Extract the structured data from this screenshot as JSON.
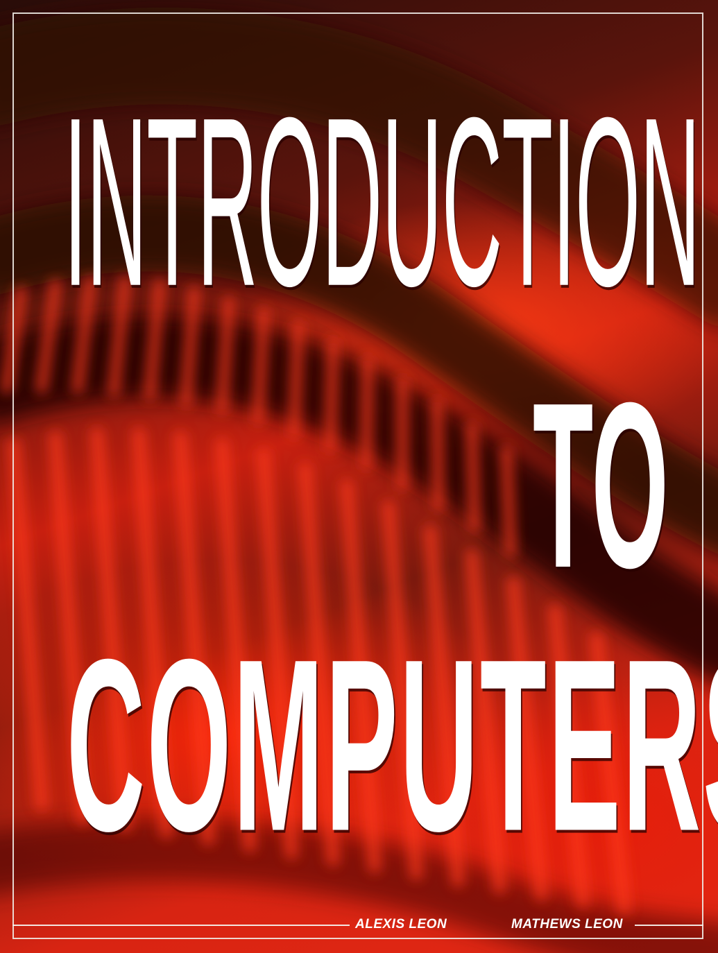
{
  "cover": {
    "title_line_1": "INTRODUCTION",
    "title_line_2": "TO",
    "title_line_3": "COMPUTERS",
    "authors": [
      "ALEXIS LEON",
      "MATHEWS LEON"
    ]
  },
  "colors": {
    "background_dark": "#2a0c08",
    "background_red": "#e42814",
    "title_text": "#ffffff",
    "frame_line": "#f0ebe6"
  }
}
